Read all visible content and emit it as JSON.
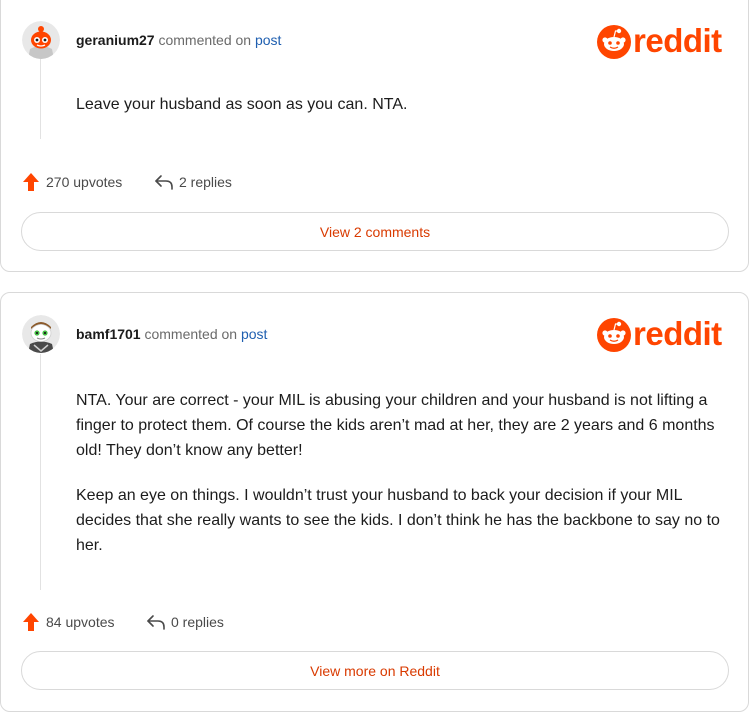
{
  "comments": [
    {
      "username": "geranium27",
      "commented_on": "commented on",
      "post_link": "post",
      "logo_text": "reddit",
      "body": [
        "Leave your husband as soon as you can. NTA."
      ],
      "upvotes": "270 upvotes",
      "replies": "2 replies",
      "button": "View 2 comments"
    },
    {
      "username": "bamf1701",
      "commented_on": "commented on",
      "post_link": "post",
      "logo_text": "reddit",
      "body": [
        "NTA. Your are correct - your MIL is abusing your children and your husband is not lifting a finger to protect them. Of course the kids aren’t mad at her, they are 2 years and 6 months old! They don’t know any better!",
        "Keep an eye on things. I wouldn’t trust your husband to back your decision if your MIL decides that she really wants to see the kids. I don’t think he has the backbone to say no to her."
      ],
      "upvotes": "84 upvotes",
      "replies": "0 replies",
      "button": "View more on Reddit"
    }
  ],
  "colors": {
    "brand": "#ff4500",
    "link": "#1f5fb0",
    "button_text": "#d93a00"
  },
  "icons": [
    "upvote-arrow-icon",
    "reply-arrow-icon",
    "reddit-snoo-icon"
  ]
}
